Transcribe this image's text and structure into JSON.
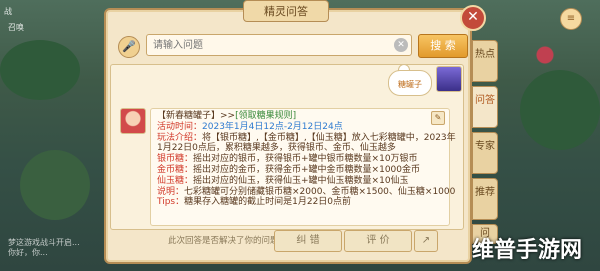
{
  "dialog": {
    "title": "精灵问答",
    "close_glyph": "✕"
  },
  "search": {
    "placeholder": "请输入问题",
    "button_label": "搜 索",
    "clear_glyph": "✕",
    "mic_glyph": "🎤"
  },
  "sticker": {
    "text": "糖罐子"
  },
  "message": {
    "title_part1": "【新春糖罐子】>>",
    "title_part2": "[领取糖果规则]",
    "lines": [
      {
        "label": "活动时间：",
        "value": "2023年1月4日12点-2月12日24点"
      },
      {
        "label": "玩法介绍：",
        "value": "将【银币糖】,【金币糖】,【仙玉糖】放入七彩糖罐中，2023年"
      },
      {
        "label": "",
        "value": "1月22日0点后，累积糖果越多，获得银币、金币、仙玉越多"
      },
      {
        "label": "银币糖：",
        "value": "摇出对应的银币，获得银币+罐中银币糖数量×10万银币"
      },
      {
        "label": "金币糖：",
        "value": "摇出对应的金币，获得金币+罐中金币糖数量×1000金币"
      },
      {
        "label": "仙玉糖：",
        "value": "摇出对应的仙玉，获得仙玉+罐中仙玉糖数量×10仙玉"
      },
      {
        "label": "说明：",
        "value": "七彩糖罐可分别储藏银币糖×2000、金币糖×1500、仙玉糖×1000"
      },
      {
        "label": "Tips：",
        "value": "糖果存入糖罐的截止时间是1月22日0点前"
      }
    ]
  },
  "footer": {
    "question": "此次回答是否解决了你的问题？",
    "correct_label": "纠 错",
    "rate_label": "评 价",
    "share_glyph": "↗"
  },
  "side_tabs": [
    "热点",
    "问答",
    "专家",
    "推荐",
    "问"
  ],
  "hud": {
    "top_left": "战",
    "left_name": "召唤",
    "bottom_left_1": "梦这游戏战斗开启...",
    "bottom_left_2": "你好，你...",
    "right_icon": "≡"
  },
  "watermark": "维普手游网"
}
